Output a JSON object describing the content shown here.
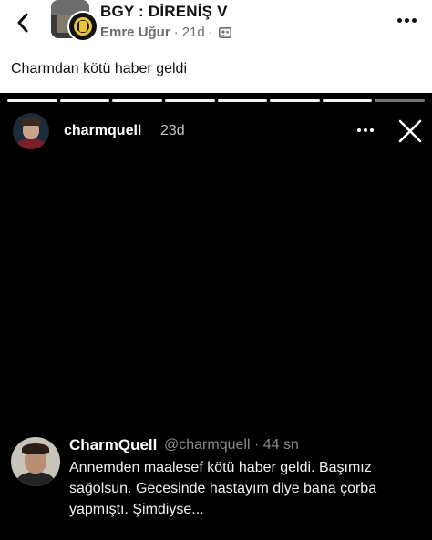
{
  "post": {
    "group_title": "BGY : DİRENİŞ V",
    "author": "Emre Uğur",
    "separator": "·",
    "time": "21d",
    "separator2": "·",
    "text": "Charmdan kötü haber geldi"
  },
  "story": {
    "username": "charmquell",
    "time": "23d",
    "progress_segments": 8,
    "progress_done": 7
  },
  "tweet": {
    "name": "CharmQuell",
    "handle_line": "@charmquell · 44 sn",
    "body": "Annemden maalesef kötü haber geldi. Başımız sağolsun. Gecesinde hastayım diye bana çorba yapmıştı. Şimdiyse..."
  },
  "icons": {
    "back": "chevron-left-icon",
    "more": "more-horizontal-icon",
    "privacy": "group-privacy-icon",
    "close": "close-icon"
  },
  "colors": {
    "story_bg": "#000000",
    "header_bg": "#ffffff",
    "meta_text": "#6b6b6b"
  }
}
